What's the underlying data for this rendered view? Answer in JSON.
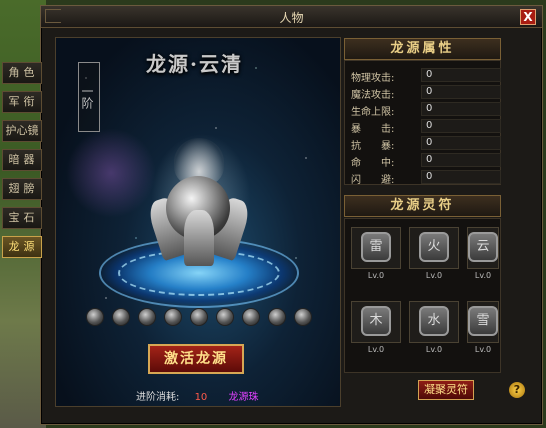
{
  "window": {
    "title": "人物",
    "close_label": "X"
  },
  "tabs": [
    {
      "label": "角色",
      "active": false
    },
    {
      "label": "军衔",
      "active": false
    },
    {
      "label": "护心镜",
      "active": false
    },
    {
      "label": "暗器",
      "active": false
    },
    {
      "label": "翅膀",
      "active": false
    },
    {
      "label": "宝石",
      "active": false
    },
    {
      "label": "龙源",
      "active": true
    }
  ],
  "scene": {
    "title": "龙源·云清",
    "stage_label": "一阶",
    "dot_count": 9,
    "activate_label": "激活龙源",
    "cost_label": "进阶消耗:",
    "cost_value": "10",
    "cost_item": "龙源珠"
  },
  "attributes": {
    "header": "龙源属性",
    "items": [
      {
        "label": "物理攻击:",
        "value": "0"
      },
      {
        "label": "魔法攻击:",
        "value": "0"
      },
      {
        "label": "生命上限:",
        "value": "0"
      },
      {
        "label": "暴　　击:",
        "value": "0"
      },
      {
        "label": "抗　　暴:",
        "value": "0"
      },
      {
        "label": "命　　中:",
        "value": "0"
      },
      {
        "label": "闪　　避:",
        "value": "0"
      }
    ]
  },
  "runes": {
    "header": "龙源灵符",
    "items": [
      {
        "glyph": "雷",
        "level": "Lv.0"
      },
      {
        "glyph": "火",
        "level": "Lv.0"
      },
      {
        "glyph": "云",
        "level": "Lv.0"
      },
      {
        "glyph": "木",
        "level": "Lv.0"
      },
      {
        "glyph": "水",
        "level": "Lv.0"
      },
      {
        "glyph": "雪",
        "level": "Lv.0"
      }
    ],
    "gather_label": "凝聚灵符",
    "help_label": "?"
  },
  "colors": {
    "accent": "#d7a754",
    "button_red": "#a32318",
    "cost_value": "#ff5a4a",
    "cost_item": "#e040ff"
  }
}
